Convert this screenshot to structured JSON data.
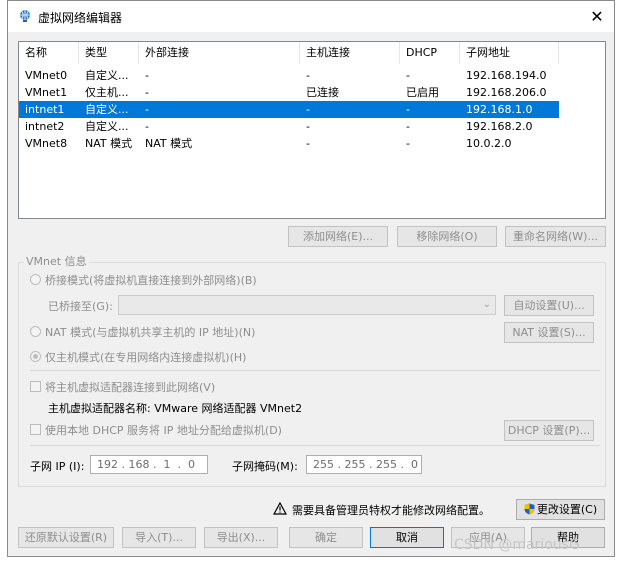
{
  "window": {
    "title": "虚拟网络编辑器",
    "close_label": "✕"
  },
  "table": {
    "headers": [
      "名称",
      "类型",
      "外部连接",
      "主机连接",
      "DHCP",
      "子网地址"
    ],
    "rows": [
      [
        "VMnet0",
        "自定义...",
        "-",
        "-",
        "-",
        "192.168.194.0"
      ],
      [
        "VMnet1",
        "仅主机...",
        "-",
        "已连接",
        "已启用",
        "192.168.206.0"
      ],
      [
        "intnet1",
        "自定义...",
        "-",
        "-",
        "-",
        "192.168.1.0"
      ],
      [
        "intnet2",
        "自定义...",
        "-",
        "-",
        "-",
        "192.168.2.0"
      ],
      [
        "VMnet8",
        "NAT 模式",
        "NAT 模式",
        "-",
        "-",
        "10.0.2.0"
      ]
    ],
    "selected_row_index": 2
  },
  "network_buttons": {
    "add": "添加网络(E)...",
    "remove": "移除网络(O)",
    "rename": "重命名网络(W)..."
  },
  "vmnet_info": {
    "title": "VMnet 信息",
    "bridge_mode": "桥接模式(将虚拟机直接连接到外部网络)(B)",
    "bridged_to_label": "已桥接至(G):",
    "auto_settings": "自动设置(U)...",
    "nat_mode": "NAT 模式(与虚拟机共享主机的 IP 地址)(N)",
    "nat_settings": "NAT 设置(S)...",
    "host_only_mode": "仅主机模式(在专用网络内连接虚拟机)(H)",
    "connect_adapter": "将主机虚拟适配器连接到此网络(V)",
    "adapter_name": "主机虚拟适配器名称: VMware 网络适配器 VMnet2",
    "use_dhcp": "使用本地 DHCP 服务将 IP 地址分配给虚拟机(D)",
    "dhcp_settings": "DHCP 设置(P)...",
    "subnet_ip_label": "子网 IP (I):",
    "subnet_ip_value": "192 . 168 .  1  .  0",
    "subnet_mask_label": "子网掩码(M):",
    "subnet_mask_value": "255 . 255 . 255 .  0"
  },
  "admin": {
    "warning": "需要具备管理员特权才能修改网络配置。",
    "change_settings": "更改设置(C)"
  },
  "bottom_buttons": {
    "restore_defaults": "还原默认设置(R)",
    "import": "导入(T)...",
    "export": "导出(X)...",
    "ok": "确定",
    "cancel": "取消",
    "apply": "应用(A)",
    "help": "帮助"
  },
  "watermark": "CSDN @mariousG",
  "colors": {
    "selection": "#0078d7",
    "disabled_text": "#8e8e8e",
    "shield_blue": "#1f5fbf",
    "shield_yellow": "#f2c200"
  }
}
